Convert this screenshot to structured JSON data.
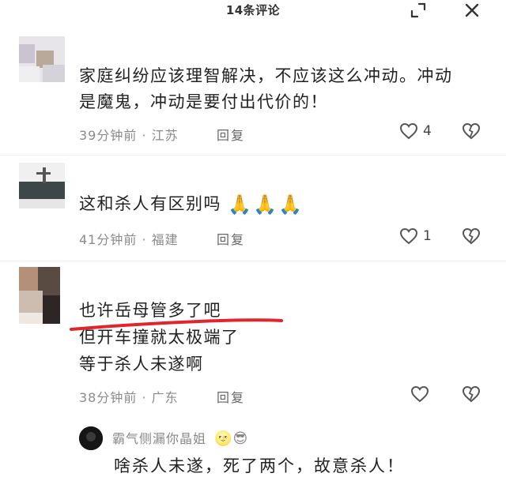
{
  "header": {
    "title": "14条评论",
    "expand_icon": "expand-icon",
    "close_icon": "close-icon"
  },
  "comments": [
    {
      "text_line1": "家庭纠纷应该理智解决，不应该这么冲动。冲动",
      "text_line2": "是魔鬼，冲动是要付出代价的！",
      "time": "39分钟前",
      "location": "江苏",
      "reply_label": "回复",
      "likes": "4"
    },
    {
      "text": "这和杀人有区别吗",
      "emojis": "🙏🙏🙏",
      "time": "41分钟前",
      "location": "福建",
      "reply_label": "回复",
      "likes": "1"
    },
    {
      "text_line1": "也许岳母管多了吧",
      "text_line2": "但开车撞就太极端了",
      "text_line3": "等于杀人未遂啊",
      "time": "38分钟前",
      "location": "广东",
      "reply_label": "回复",
      "likes": ""
    }
  ],
  "reply_preview": {
    "username": "霸气侧漏你晶姐",
    "emojis": "🌝😎",
    "text": "啥杀人未遂，死了两个，故意杀人！"
  },
  "colors": {
    "underline": "#e0262b",
    "meta": "#8a8a8a",
    "text": "#222222"
  }
}
